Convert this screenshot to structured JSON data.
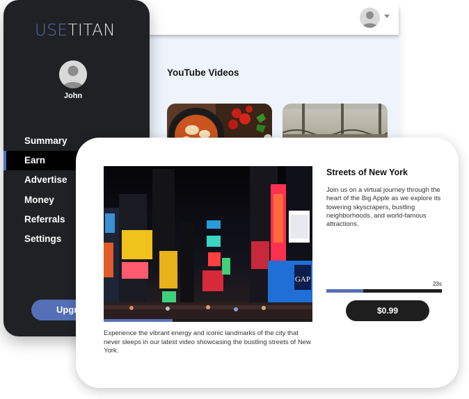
{
  "brand": {
    "part1": "USE",
    "part2": "TITAN"
  },
  "user": {
    "name": "John"
  },
  "sidebar": {
    "items": [
      {
        "label": "Summary"
      },
      {
        "label": "Earn"
      },
      {
        "label": "Advertise"
      },
      {
        "label": "Money"
      },
      {
        "label": "Referrals"
      },
      {
        "label": "Settings"
      }
    ],
    "active_item": "Earn",
    "upgrade_label": "Upgr"
  },
  "main": {
    "section_title": "YouTube Videos"
  },
  "video": {
    "title": "Streets of New York",
    "summary": "Join us on a virtual journey through the heart of the Big Apple as we explore its towering skyscrapers, bustling neighborhoods, and world-famous attractions.",
    "description": "Experience the vibrant energy and iconic landmarks of the city that never sleeps in our latest video showcasing the bustling streets of New York.",
    "playback_progress": 0.33,
    "timer": "23s",
    "timer_progress": 0.32,
    "price_label": "$0.99",
    "sign_text": "GAP"
  },
  "colors": {
    "accent": "#5670b8",
    "sidebar_bg": "#202124",
    "panel_bg": "#eef3fc",
    "button_dark": "#1e1e1e"
  },
  "icons": [
    "user-avatar-icon",
    "chevron-down-icon"
  ]
}
